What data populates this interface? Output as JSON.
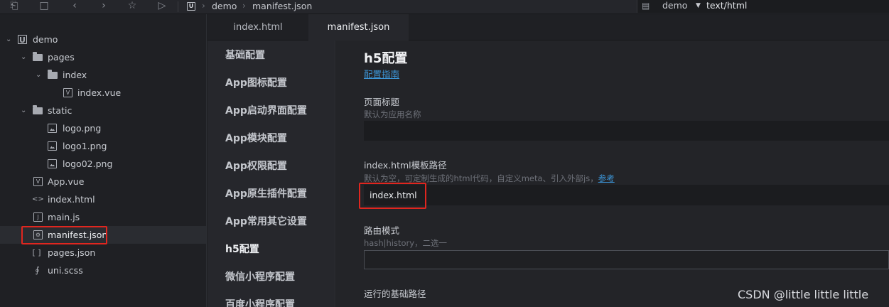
{
  "breadcrumb": {
    "project": "demo",
    "file": "manifest.json"
  },
  "run_target": {
    "label": "demo",
    "type": "text/html"
  },
  "toolbar_icons": [
    "new-file-icon",
    "save-icon",
    "back-icon",
    "forward-icon",
    "star-icon",
    "run-icon"
  ],
  "file_tree": [
    {
      "label": "demo",
      "kind": "project",
      "icon": "uni-badge",
      "depth": 0,
      "expanded": true
    },
    {
      "label": "pages",
      "kind": "folder",
      "depth": 1,
      "expanded": true
    },
    {
      "label": "index",
      "kind": "folder",
      "depth": 2,
      "expanded": true
    },
    {
      "label": "index.vue",
      "kind": "vue",
      "depth": 3
    },
    {
      "label": "static",
      "kind": "folder",
      "depth": 1,
      "expanded": true
    },
    {
      "label": "logo.png",
      "kind": "image",
      "depth": 2
    },
    {
      "label": "logo1.png",
      "kind": "image",
      "depth": 2
    },
    {
      "label": "logo02.png",
      "kind": "image",
      "depth": 2
    },
    {
      "label": "App.vue",
      "kind": "vue",
      "depth": 1
    },
    {
      "label": "index.html",
      "kind": "html",
      "depth": 1
    },
    {
      "label": "main.js",
      "kind": "js",
      "depth": 1
    },
    {
      "label": "manifest.json",
      "kind": "json-settings",
      "depth": 1,
      "selected": true
    },
    {
      "label": "pages.json",
      "kind": "json",
      "depth": 1
    },
    {
      "label": "uni.scss",
      "kind": "scss",
      "depth": 1
    }
  ],
  "tabs": [
    {
      "label": "index.html",
      "active": false
    },
    {
      "label": "manifest.json",
      "active": true
    }
  ],
  "settings_nav": [
    {
      "label": "基础配置",
      "active": false
    },
    {
      "label": "App图标配置",
      "active": false
    },
    {
      "label": "App启动界面配置",
      "active": false
    },
    {
      "label": "App模块配置",
      "active": false
    },
    {
      "label": "App权限配置",
      "active": false
    },
    {
      "label": "App原生插件配置",
      "active": false
    },
    {
      "label": "App常用其它设置",
      "active": false
    },
    {
      "label": "h5配置",
      "active": true
    },
    {
      "label": "微信小程序配置",
      "active": false
    },
    {
      "label": "百度小程序配置",
      "active": false
    }
  ],
  "form": {
    "title": "h5配置",
    "guide_link": "配置指南",
    "page_title": {
      "label": "页面标题",
      "hint": "默认为应用名称",
      "value": ""
    },
    "template_path": {
      "label": "index.html模板路径",
      "hint": "默认为空，可定制生成的html代码，自定义meta、引入外部js，",
      "hint_link": "参考",
      "value": "index.html"
    },
    "router_mode": {
      "label": "路由模式",
      "hint": "hash|history，二选一",
      "value": ""
    },
    "base_path": {
      "label": "运行的基础路径"
    }
  },
  "watermark": "CSDN @little little little",
  "colors": {
    "highlight_box": "#e0261f",
    "link": "#3c96d9",
    "background": "#1e1f22"
  }
}
